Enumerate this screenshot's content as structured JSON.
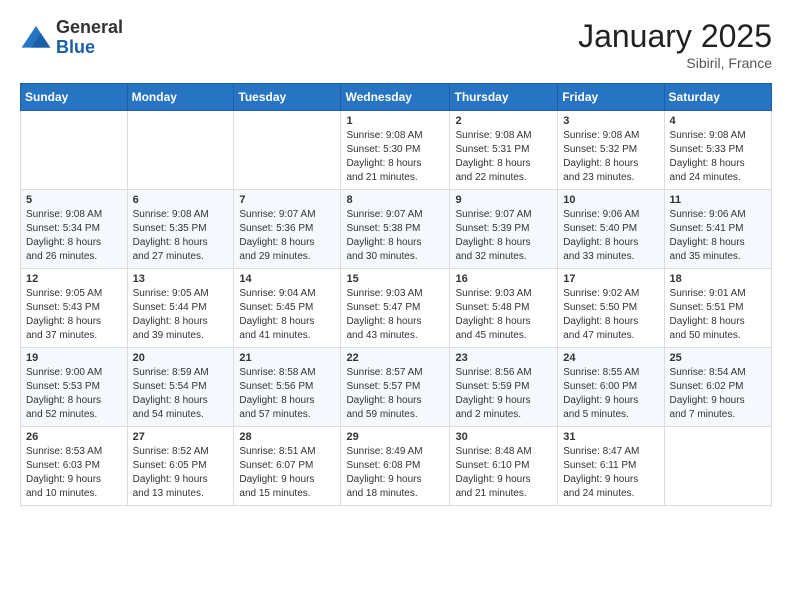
{
  "logo": {
    "general": "General",
    "blue": "Blue"
  },
  "header": {
    "month": "January 2025",
    "location": "Sibiril, France"
  },
  "weekdays": [
    "Sunday",
    "Monday",
    "Tuesday",
    "Wednesday",
    "Thursday",
    "Friday",
    "Saturday"
  ],
  "weeks": [
    [
      {
        "day": "",
        "info": ""
      },
      {
        "day": "",
        "info": ""
      },
      {
        "day": "",
        "info": ""
      },
      {
        "day": "1",
        "info": "Sunrise: 9:08 AM\nSunset: 5:30 PM\nDaylight: 8 hours and 21 minutes."
      },
      {
        "day": "2",
        "info": "Sunrise: 9:08 AM\nSunset: 5:31 PM\nDaylight: 8 hours and 22 minutes."
      },
      {
        "day": "3",
        "info": "Sunrise: 9:08 AM\nSunset: 5:32 PM\nDaylight: 8 hours and 23 minutes."
      },
      {
        "day": "4",
        "info": "Sunrise: 9:08 AM\nSunset: 5:33 PM\nDaylight: 8 hours and 24 minutes."
      }
    ],
    [
      {
        "day": "5",
        "info": "Sunrise: 9:08 AM\nSunset: 5:34 PM\nDaylight: 8 hours and 26 minutes."
      },
      {
        "day": "6",
        "info": "Sunrise: 9:08 AM\nSunset: 5:35 PM\nDaylight: 8 hours and 27 minutes."
      },
      {
        "day": "7",
        "info": "Sunrise: 9:07 AM\nSunset: 5:36 PM\nDaylight: 8 hours and 29 minutes."
      },
      {
        "day": "8",
        "info": "Sunrise: 9:07 AM\nSunset: 5:38 PM\nDaylight: 8 hours and 30 minutes."
      },
      {
        "day": "9",
        "info": "Sunrise: 9:07 AM\nSunset: 5:39 PM\nDaylight: 8 hours and 32 minutes."
      },
      {
        "day": "10",
        "info": "Sunrise: 9:06 AM\nSunset: 5:40 PM\nDaylight: 8 hours and 33 minutes."
      },
      {
        "day": "11",
        "info": "Sunrise: 9:06 AM\nSunset: 5:41 PM\nDaylight: 8 hours and 35 minutes."
      }
    ],
    [
      {
        "day": "12",
        "info": "Sunrise: 9:05 AM\nSunset: 5:43 PM\nDaylight: 8 hours and 37 minutes."
      },
      {
        "day": "13",
        "info": "Sunrise: 9:05 AM\nSunset: 5:44 PM\nDaylight: 8 hours and 39 minutes."
      },
      {
        "day": "14",
        "info": "Sunrise: 9:04 AM\nSunset: 5:45 PM\nDaylight: 8 hours and 41 minutes."
      },
      {
        "day": "15",
        "info": "Sunrise: 9:03 AM\nSunset: 5:47 PM\nDaylight: 8 hours and 43 minutes."
      },
      {
        "day": "16",
        "info": "Sunrise: 9:03 AM\nSunset: 5:48 PM\nDaylight: 8 hours and 45 minutes."
      },
      {
        "day": "17",
        "info": "Sunrise: 9:02 AM\nSunset: 5:50 PM\nDaylight: 8 hours and 47 minutes."
      },
      {
        "day": "18",
        "info": "Sunrise: 9:01 AM\nSunset: 5:51 PM\nDaylight: 8 hours and 50 minutes."
      }
    ],
    [
      {
        "day": "19",
        "info": "Sunrise: 9:00 AM\nSunset: 5:53 PM\nDaylight: 8 hours and 52 minutes."
      },
      {
        "day": "20",
        "info": "Sunrise: 8:59 AM\nSunset: 5:54 PM\nDaylight: 8 hours and 54 minutes."
      },
      {
        "day": "21",
        "info": "Sunrise: 8:58 AM\nSunset: 5:56 PM\nDaylight: 8 hours and 57 minutes."
      },
      {
        "day": "22",
        "info": "Sunrise: 8:57 AM\nSunset: 5:57 PM\nDaylight: 8 hours and 59 minutes."
      },
      {
        "day": "23",
        "info": "Sunrise: 8:56 AM\nSunset: 5:59 PM\nDaylight: 9 hours and 2 minutes."
      },
      {
        "day": "24",
        "info": "Sunrise: 8:55 AM\nSunset: 6:00 PM\nDaylight: 9 hours and 5 minutes."
      },
      {
        "day": "25",
        "info": "Sunrise: 8:54 AM\nSunset: 6:02 PM\nDaylight: 9 hours and 7 minutes."
      }
    ],
    [
      {
        "day": "26",
        "info": "Sunrise: 8:53 AM\nSunset: 6:03 PM\nDaylight: 9 hours and 10 minutes."
      },
      {
        "day": "27",
        "info": "Sunrise: 8:52 AM\nSunset: 6:05 PM\nDaylight: 9 hours and 13 minutes."
      },
      {
        "day": "28",
        "info": "Sunrise: 8:51 AM\nSunset: 6:07 PM\nDaylight: 9 hours and 15 minutes."
      },
      {
        "day": "29",
        "info": "Sunrise: 8:49 AM\nSunset: 6:08 PM\nDaylight: 9 hours and 18 minutes."
      },
      {
        "day": "30",
        "info": "Sunrise: 8:48 AM\nSunset: 6:10 PM\nDaylight: 9 hours and 21 minutes."
      },
      {
        "day": "31",
        "info": "Sunrise: 8:47 AM\nSunset: 6:11 PM\nDaylight: 9 hours and 24 minutes."
      },
      {
        "day": "",
        "info": ""
      }
    ]
  ]
}
